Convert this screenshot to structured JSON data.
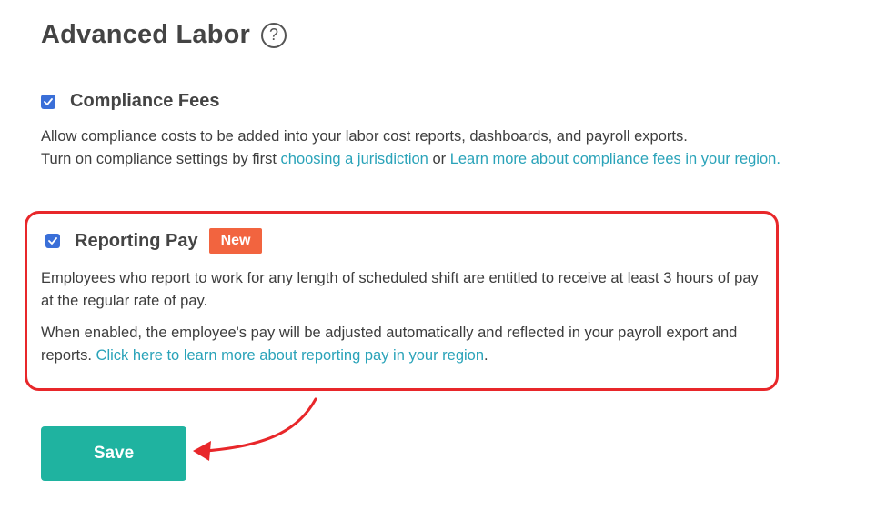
{
  "header": {
    "title": "Advanced Labor",
    "help_icon": "?"
  },
  "compliance_fees": {
    "checked": true,
    "label": "Compliance Fees",
    "text_1": "Allow compliance costs to be added into your labor cost reports, dashboards, and payroll exports.",
    "text_2": "Turn on compliance settings by first ",
    "link_jurisdiction": "choosing a jurisdiction",
    "text_or": " or ",
    "link_learn_more": "Learn more about compliance fees in your region."
  },
  "reporting_pay": {
    "checked": true,
    "label": "Reporting Pay",
    "badge": "New",
    "paragraph_1": "Employees who report to work for any length of scheduled shift are entitled to receive at least 3 hours of pay at the regular rate of pay.",
    "paragraph_2_text": "When enabled, the employee's pay will be adjusted automatically and reflected in your payroll export and reports. ",
    "paragraph_2_link": "Click here to learn more about reporting pay in your region",
    "paragraph_2_end": "."
  },
  "actions": {
    "save_label": "Save"
  },
  "colors": {
    "accent_link": "#2aa3b9",
    "checkbox": "#3a6fd8",
    "badge": "#f2643f",
    "save_button": "#1fb3a0",
    "annotation_red": "#e8272a"
  },
  "icons": {
    "checkbox": "check-icon",
    "help": "question-circle-icon",
    "annotation": "curved-arrow-icon"
  }
}
